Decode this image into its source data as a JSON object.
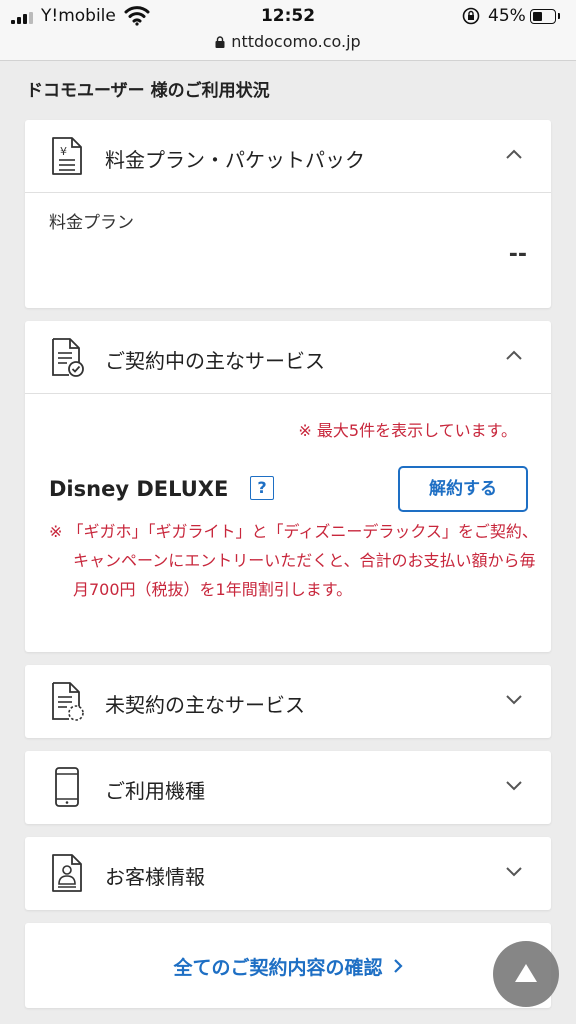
{
  "status_bar": {
    "carrier": "Y!mobile",
    "time": "12:52",
    "battery_percent": "45%",
    "battery_level": 0.45,
    "url": "nttdocomo.co.jp"
  },
  "page_title": "ドコモユーザー 様のご利用状況",
  "plan_section": {
    "title": "料金プラン・パケットパック",
    "icon": "yen-document-icon",
    "expanded": true,
    "plan_label": "料金プラン",
    "plan_value": "--"
  },
  "contracted_section": {
    "title": "ご契約中の主なサービス",
    "icon": "document-check-icon",
    "expanded": true,
    "notice": "※ 最大5件を表示しています。",
    "service_name": "Disney DELUXE",
    "help_label": "?",
    "cancel_label": "解約する",
    "campaign_note": "※ 「ギガホ」「ギガライト」と「ディズニーデラックス」をご契約、キャンペーンにエントリーいただくと、合計のお支払い額から毎月700円（税抜）を1年間割引します。"
  },
  "uncontracted_section": {
    "title": "未契約の主なサービス",
    "icon": "document-dashed-icon",
    "expanded": false
  },
  "device_section": {
    "title": "ご利用機種",
    "icon": "smartphone-icon",
    "expanded": false
  },
  "customer_section": {
    "title": "お客様情報",
    "icon": "person-card-icon",
    "expanded": false
  },
  "all_contracts_link": "全てのご契約内容の確認",
  "scroll_top_button": "triangle-up-icon",
  "colors": {
    "accent_blue": "#1e6fc4",
    "notice_red": "#c8273c",
    "background": "#ececec"
  }
}
